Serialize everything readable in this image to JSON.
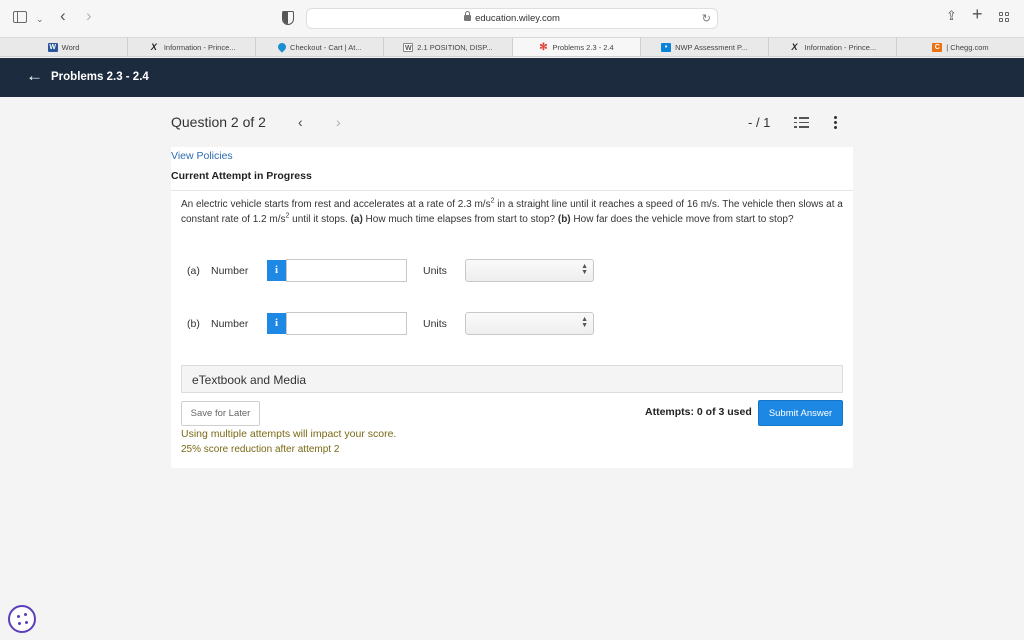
{
  "browser": {
    "url": "education.wiley.com",
    "tabs": [
      {
        "label": "Word",
        "favicon": "word-icon"
      },
      {
        "label": "Information - Prince...",
        "favicon": "xf-icon"
      },
      {
        "label": "Checkout - Cart | At...",
        "favicon": "drop-icon"
      },
      {
        "label": "2.1 POSITION, DISP...",
        "favicon": "w-icon"
      },
      {
        "label": "Problems 2.3 - 2.4",
        "favicon": "gear-icon"
      },
      {
        "label": "NWP Assessment P...",
        "favicon": "nwp-icon"
      },
      {
        "label": "Information - Prince...",
        "favicon": "xf-icon"
      },
      {
        "label": "| Chegg.com",
        "favicon": "chegg-icon"
      }
    ]
  },
  "header": {
    "title": "Problems 2.3 - 2.4"
  },
  "question_nav": {
    "label": "Question 2 of 2",
    "score": "- / 1"
  },
  "content": {
    "view_policies": "View Policies",
    "attempt_title": "Current Attempt in Progress",
    "question_text": {
      "part1": "An electric vehicle starts from rest and accelerates at a rate of 2.3 m/s",
      "sup1": "2",
      "part2": " in a straight line until it reaches a speed of 16 m/s. The vehicle then slows at a constant rate of 1.2 m/s",
      "sup2": "2",
      "part3": " until it stops. ",
      "bold1": "(a)",
      "part4": " How much time elapses from start to stop? ",
      "bold2": "(b)",
      "part5": " How far does the vehicle move from start to stop?"
    },
    "answers": [
      {
        "label": "(a)",
        "type": "Number",
        "info": "i",
        "value": "",
        "units_label": "Units",
        "units_value": ""
      },
      {
        "label": "(b)",
        "type": "Number",
        "info": "i",
        "value": "",
        "units_label": "Units",
        "units_value": ""
      }
    ],
    "etextbook": "eTextbook and Media",
    "save_label": "Save for Later",
    "attempts": "Attempts: 0 of 3 used",
    "submit_label": "Submit Answer",
    "warning1": "Using multiple attempts will impact your score.",
    "warning2": "25% score reduction after attempt 2"
  },
  "colors": {
    "appbar": "#1c2b3d",
    "accent": "#1c88e3",
    "warning_text": "#7a6a14",
    "link": "#2b6cb0",
    "cookie": "#5b3fb8"
  }
}
